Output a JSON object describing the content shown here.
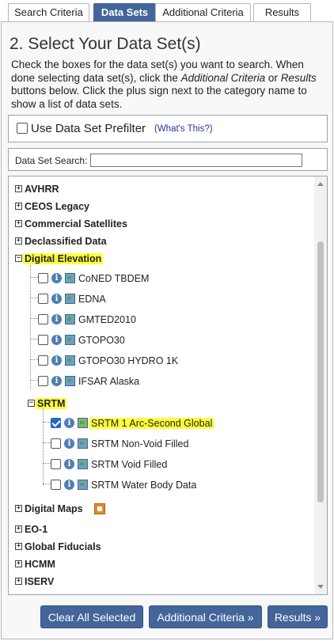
{
  "tabs": [
    {
      "label": "Search Criteria"
    },
    {
      "label": "Data Sets"
    },
    {
      "label": "Additional Criteria"
    },
    {
      "label": "Results"
    }
  ],
  "heading": "2. Select Your Data Set(s)",
  "instructions": {
    "part1": "Check the boxes for the data set(s) you want to search. When done selecting data set(s), click the ",
    "em1": "Additional Criteria",
    "part2": " or ",
    "em2": "Results",
    "part3": " buttons below. Click the plus sign next to the category name to show a list of data sets."
  },
  "prefilter": {
    "label": "Use Data Set Prefilter",
    "whats_this": "(What's This?)",
    "checked": false
  },
  "search": {
    "label": "Data Set Search:",
    "value": "",
    "placeholder": ""
  },
  "tree": {
    "categories": [
      {
        "label": "AVHRR",
        "expander": "+"
      },
      {
        "label": "CEOS Legacy",
        "expander": "+"
      },
      {
        "label": "Commercial Satellites",
        "expander": "+"
      },
      {
        "label": "Declassified Data",
        "expander": "+"
      },
      {
        "label": "Digital Elevation",
        "expander": "−"
      },
      {
        "label": "Digital Maps",
        "expander": "+"
      },
      {
        "label": "EO-1",
        "expander": "+"
      },
      {
        "label": "Global Fiducials",
        "expander": "+"
      },
      {
        "label": "HCMM",
        "expander": "+"
      },
      {
        "label": "ISERV",
        "expander": "+"
      }
    ],
    "digital_elevation_items": [
      {
        "label": "CoNED TBDEM",
        "checked": false
      },
      {
        "label": "EDNA",
        "checked": false
      },
      {
        "label": "GMTED2010",
        "checked": false
      },
      {
        "label": "GTOPO30",
        "checked": false
      },
      {
        "label": "GTOPO30 HYDRO 1K",
        "checked": false
      },
      {
        "label": "IFSAR Alaska",
        "checked": false
      }
    ],
    "srtm": {
      "label": "SRTM",
      "expander": "−",
      "items": [
        {
          "label": "SRTM 1 Arc-Second Global",
          "checked": true
        },
        {
          "label": "SRTM Non-Void Filled",
          "checked": false
        },
        {
          "label": "SRTM Void Filled",
          "checked": false
        },
        {
          "label": "SRTM Water Body Data",
          "checked": false
        }
      ]
    }
  },
  "buttons": {
    "clear": "Clear All Selected",
    "additional": "Additional Criteria »",
    "results": "Results »"
  },
  "colors": {
    "accent": "#43659a",
    "highlight": "#ffff3c",
    "link": "#2535a0"
  }
}
